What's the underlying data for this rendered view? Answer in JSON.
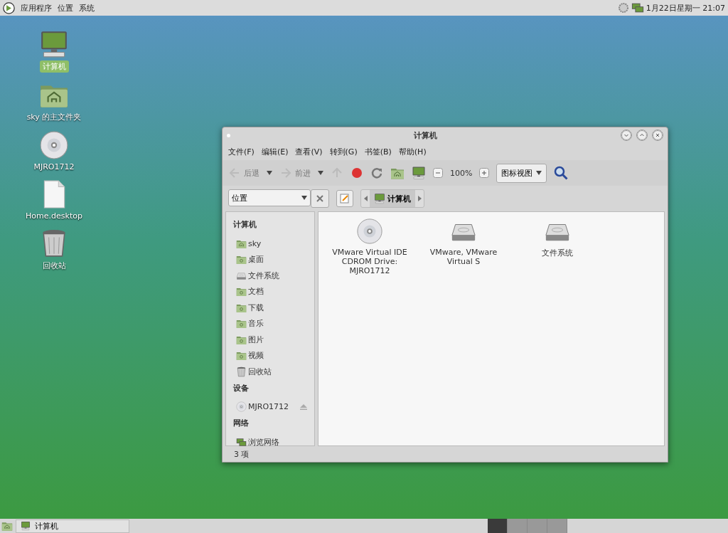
{
  "top_panel": {
    "menus": [
      "应用程序",
      "位置",
      "系统"
    ],
    "clock": "1月22日星期一 21:07"
  },
  "desktop_icons": [
    {
      "label": "计算机",
      "kind": "computer",
      "selected": true
    },
    {
      "label": "sky 的主文件夹",
      "kind": "home",
      "selected": false
    },
    {
      "label": "MJRO1712",
      "kind": "disc",
      "selected": false
    },
    {
      "label": "Home.desktop",
      "kind": "file",
      "selected": false
    },
    {
      "label": "回收站",
      "kind": "trash",
      "selected": false
    }
  ],
  "window": {
    "title": "计算机",
    "menus": [
      "文件(F)",
      "编辑(E)",
      "查看(V)",
      "转到(G)",
      "书签(B)",
      "帮助(H)"
    ],
    "toolbar": {
      "back": {
        "label": "后退",
        "disabled": true
      },
      "forward": {
        "label": "前进",
        "disabled": true
      },
      "zoom": "100%",
      "view": "图标视图"
    },
    "location": {
      "places": "位置",
      "breadcrumb": "计算机"
    },
    "sidebar": [
      {
        "title": "计算机",
        "items": [
          {
            "label": "sky",
            "kind": "home"
          },
          {
            "label": "桌面",
            "kind": "folder"
          },
          {
            "label": "文件系统",
            "kind": "drive"
          },
          {
            "label": "文档",
            "kind": "folder"
          },
          {
            "label": "下载",
            "kind": "folder"
          },
          {
            "label": "音乐",
            "kind": "folder"
          },
          {
            "label": "图片",
            "kind": "folder"
          },
          {
            "label": "视频",
            "kind": "folder"
          },
          {
            "label": "回收站",
            "kind": "trash"
          }
        ]
      },
      {
        "title": "设备",
        "items": [
          {
            "label": "MJRO1712",
            "kind": "disc",
            "eject": true
          }
        ]
      },
      {
        "title": "网络",
        "items": [
          {
            "label": "浏览网络",
            "kind": "network"
          }
        ]
      }
    ],
    "files": [
      {
        "label": "VMware Virtual IDE CDROM Drive: MJRO1712",
        "kind": "disc"
      },
      {
        "label": "VMware, VMware Virtual S",
        "kind": "drive"
      },
      {
        "label": "文件系统",
        "kind": "drive"
      }
    ],
    "status": "3 项"
  },
  "taskbar": {
    "windows": [
      {
        "label": "计算机"
      }
    ],
    "workspaces": [
      {
        "selected": true
      },
      {
        "selected": false
      },
      {
        "selected": false
      },
      {
        "selected": false
      }
    ]
  }
}
